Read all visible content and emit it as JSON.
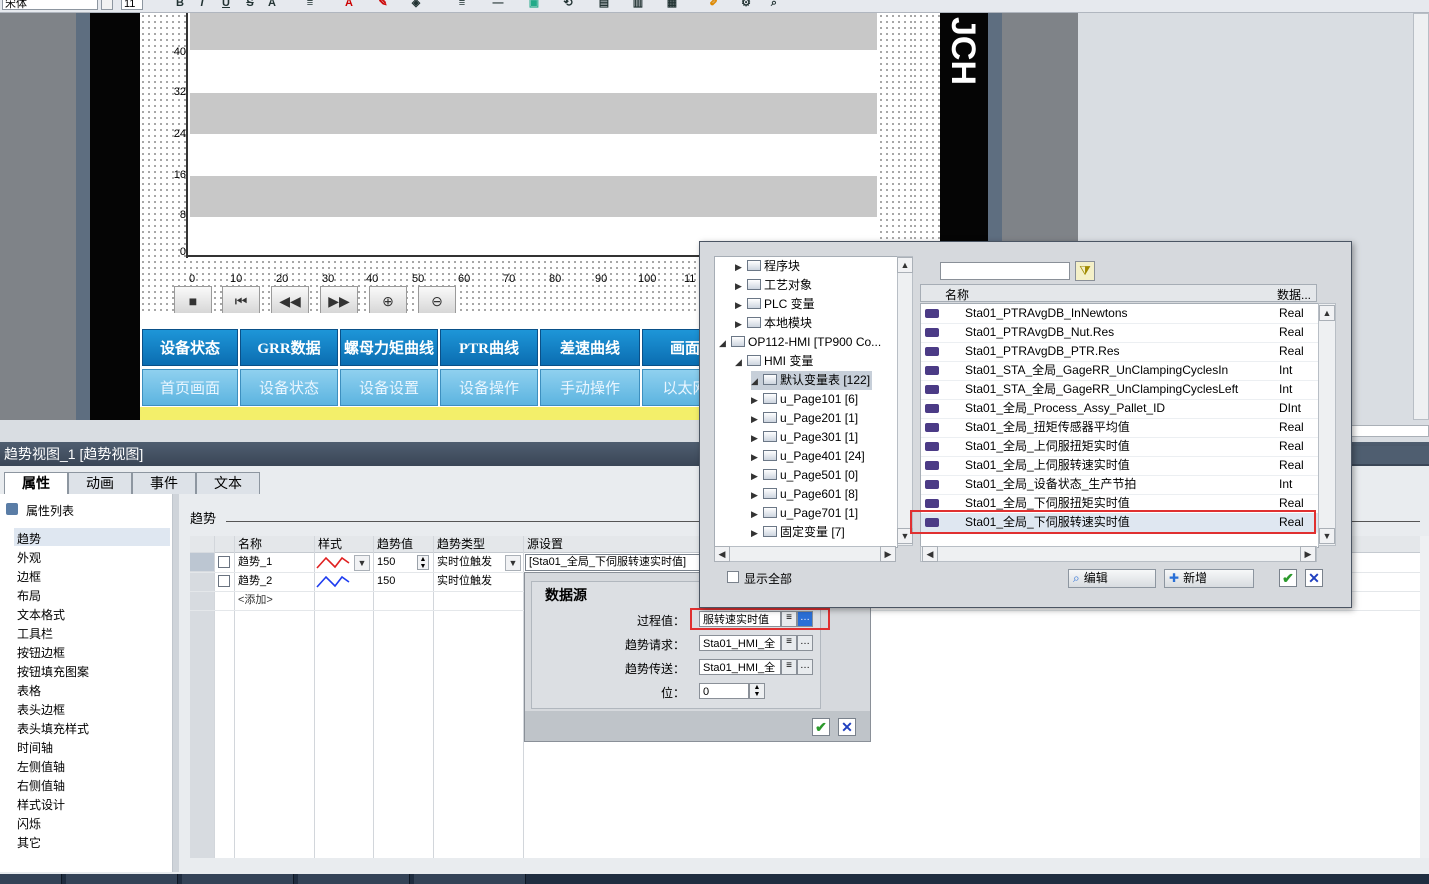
{
  "toolbar": {
    "font_name": "宋体",
    "font_size": "11"
  },
  "trend_view": {
    "y_ticks": [
      "40",
      "32",
      "24",
      "16",
      "8",
      "0"
    ],
    "x_ticks": [
      "0",
      "10",
      "20",
      "30",
      "40",
      "50",
      "60",
      "70",
      "80",
      "90",
      "100",
      "11"
    ],
    "side_text": "JCH"
  },
  "nav_row1": [
    "设备状态",
    "GRR数据",
    "螺母力矩曲线",
    "PTR曲线",
    "差速曲线",
    "画面"
  ],
  "nav_row2": [
    "首页画面",
    "设备状态",
    "设备设置",
    "设备操作",
    "手动操作",
    "以太网"
  ],
  "inspector": {
    "title": "趋势视图_1 [趋势视图]",
    "tabs": [
      "属性",
      "动画",
      "事件",
      "文本"
    ],
    "property_list_label": "属性列表",
    "nav_items": [
      "趋势",
      "外观",
      "边框",
      "布局",
      "文本格式",
      "工具栏",
      "按钮边框",
      "按钮填充图案",
      "表格",
      "表头边框",
      "表头填充样式",
      "时间轴",
      "左侧值轴",
      "右侧值轴",
      "样式设计",
      "闪烁",
      "其它"
    ],
    "section_title": "趋势"
  },
  "trend_table": {
    "headers": [
      "名称",
      "样式",
      "趋势值",
      "趋势类型",
      "源设置"
    ],
    "rows": [
      {
        "name": "趋势_1",
        "value": "150",
        "type": "实时位触发",
        "source": "[Sta01_全局_下伺服转速实时值]"
      },
      {
        "name": "趋势_2",
        "value": "150",
        "type": "实时位触发",
        "source": ""
      }
    ],
    "add_label": "<添加>",
    "colors": {
      "trend_1": "#e02020",
      "trend_2": "#1e3cf0"
    }
  },
  "data_source": {
    "title": "数据源",
    "fields": [
      {
        "label": "过程值：",
        "value": "服转速实时值"
      },
      {
        "label": "趋势请求：",
        "value": "Sta01_HMI_全"
      },
      {
        "label": "趋势传送：",
        "value": "Sta01_HMI_全"
      },
      {
        "label": "位：",
        "value": "0"
      }
    ]
  },
  "tag_picker": {
    "tree": [
      {
        "label": "程序块",
        "arrow": "▶"
      },
      {
        "label": "工艺对象",
        "arrow": "▶"
      },
      {
        "label": "PLC 变量",
        "arrow": "▶"
      },
      {
        "label": "本地模块",
        "arrow": "▶"
      },
      {
        "label": "OP112-HMI [TP900 Co...",
        "arrow": "◢"
      },
      {
        "label": "HMI 变量",
        "arrow": "◢"
      },
      {
        "label": "默认变量表 [122]",
        "arrow": "◢"
      },
      {
        "label": "u_Page101 [6]",
        "arrow": "▶"
      },
      {
        "label": "u_Page201 [1]",
        "arrow": "▶"
      },
      {
        "label": "u_Page301 [1]",
        "arrow": "▶"
      },
      {
        "label": "u_Page401 [24]",
        "arrow": "▶"
      },
      {
        "label": "u_Page501 [0]",
        "arrow": "▶"
      },
      {
        "label": "u_Page601 [8]",
        "arrow": "▶"
      },
      {
        "label": "u_Page701 [1]",
        "arrow": "▶"
      },
      {
        "label": "固定变量 [7]",
        "arrow": "▶"
      }
    ],
    "column_name": "名称",
    "column_type": "数据...",
    "tags": [
      {
        "name": "Sta01_PTRAvgDB_InNewtons",
        "type": "Real"
      },
      {
        "name": "Sta01_PTRAvgDB_Nut.Res",
        "type": "Real"
      },
      {
        "name": "Sta01_PTRAvgDB_PTR.Res",
        "type": "Real"
      },
      {
        "name": "Sta01_STA_全局_GageRR_UnClampingCyclesIn",
        "type": "Int"
      },
      {
        "name": "Sta01_STA_全局_GageRR_UnClampingCyclesLeft",
        "type": "Int"
      },
      {
        "name": "Sta01_全局_Process_Assy_Pallet_ID",
        "type": "DInt"
      },
      {
        "name": "Sta01_全局_扭矩传感器平均值",
        "type": "Real"
      },
      {
        "name": "Sta01_全局_上伺服扭矩实时值",
        "type": "Real"
      },
      {
        "name": "Sta01_全局_上伺服转速实时值",
        "type": "Real"
      },
      {
        "name": "Sta01_全局_设备状态_生产节拍",
        "type": "Int"
      },
      {
        "name": "Sta01_全局_下伺服扭矩实时值",
        "type": "Real"
      },
      {
        "name": "Sta01_全局_下伺服转速实时值",
        "type": "Real"
      }
    ],
    "show_all": "显示全部",
    "edit_label": "编辑",
    "new_label": "新增",
    "highlight_color": "#e03030"
  }
}
